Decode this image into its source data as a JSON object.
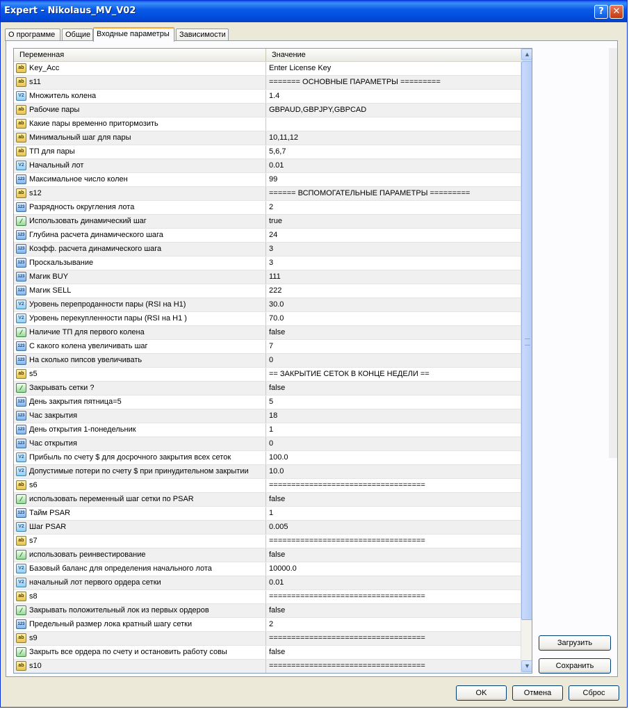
{
  "window": {
    "title": "Expert - Nikolaus_MV_V02",
    "help_glyph": "?",
    "close_glyph": "✕"
  },
  "tabs": [
    {
      "label": "О программе"
    },
    {
      "label": "Общие"
    },
    {
      "label": "Входные параметры"
    },
    {
      "label": "Зависимости"
    }
  ],
  "table": {
    "columns": {
      "name": "Переменная",
      "value": "Значение"
    },
    "rows": [
      {
        "icon": "ab",
        "name": "Key_Acc",
        "value": "Enter License Key"
      },
      {
        "icon": "ab",
        "name": "s11",
        "value": "======= ОСНОВНЫЕ ПАРАМЕТРЫ ========="
      },
      {
        "icon": "v2",
        "name": "Множитель колена",
        "value": "1.4"
      },
      {
        "icon": "ab",
        "name": "Рабочие пары",
        "value": "GBPAUD,GBPJPY,GBPCAD"
      },
      {
        "icon": "ab",
        "name": "Какие пары временно притормозить",
        "value": ""
      },
      {
        "icon": "ab",
        "name": "Минимальный шаг для пары",
        "value": "10,11,12"
      },
      {
        "icon": "ab",
        "name": "ТП для пары",
        "value": "5,6,7"
      },
      {
        "icon": "v2",
        "name": "Начальный лот",
        "value": "0.01"
      },
      {
        "icon": "123",
        "name": "Максимальное число колен",
        "value": "99"
      },
      {
        "icon": "ab",
        "name": "s12",
        "value": "====== ВСПОМОГАТЕЛЬНЫЕ ПАРАМЕТРЫ ========="
      },
      {
        "icon": "123",
        "name": "Разрядность округления лота",
        "value": "2"
      },
      {
        "icon": "bool",
        "name": "Использовать динамический шаг",
        "value": "true"
      },
      {
        "icon": "123",
        "name": "Глубина расчета динамического шага",
        "value": "24"
      },
      {
        "icon": "123",
        "name": "Коэфф. расчета динамического шага",
        "value": "3"
      },
      {
        "icon": "123",
        "name": "Проскальзывание",
        "value": "3"
      },
      {
        "icon": "123",
        "name": "Магик BUY",
        "value": "111"
      },
      {
        "icon": "123",
        "name": "Магик SELL",
        "value": "222"
      },
      {
        "icon": "v2",
        "name": "Уровень перепроданности пары (RSI на H1)",
        "value": "30.0"
      },
      {
        "icon": "v2",
        "name": "Уровень перекупленности пары (RSI на H1 )",
        "value": "70.0"
      },
      {
        "icon": "bool",
        "name": "Наличие ТП для первого колена",
        "value": "false"
      },
      {
        "icon": "123",
        "name": "С какого колена увеличивать шаг",
        "value": "7"
      },
      {
        "icon": "123",
        "name": "На сколько пипсов увеличивать",
        "value": "0"
      },
      {
        "icon": "ab",
        "name": "s5",
        "value": "== ЗАКРЫТИЕ СЕТОК В КОНЦЕ НЕДЕЛИ =="
      },
      {
        "icon": "bool",
        "name": "Закрывать сетки ?",
        "value": "false"
      },
      {
        "icon": "123",
        "name": "День закрытия пятница=5",
        "value": "5"
      },
      {
        "icon": "123",
        "name": "Час закрытия",
        "value": "18"
      },
      {
        "icon": "123",
        "name": "День открытия 1-понедельник",
        "value": "1"
      },
      {
        "icon": "123",
        "name": "Час открытия",
        "value": "0"
      },
      {
        "icon": "v2",
        "name": "Прибыль по счету $ для досрочного закрытия всех сеток",
        "value": "100.0"
      },
      {
        "icon": "v2",
        "name": "Допустимые потери по счету $ при принудительном закрытии",
        "value": "10.0"
      },
      {
        "icon": "ab",
        "name": "s6",
        "value": "==================================="
      },
      {
        "icon": "bool",
        "name": "использовать переменный шаг сетки по PSAR",
        "value": "false"
      },
      {
        "icon": "123",
        "name": "Тайм PSAR",
        "value": "1"
      },
      {
        "icon": "v2",
        "name": "Шаг PSAR",
        "value": "0.005"
      },
      {
        "icon": "ab",
        "name": "s7",
        "value": "==================================="
      },
      {
        "icon": "bool",
        "name": "использовать реинвестирование",
        "value": "false"
      },
      {
        "icon": "v2",
        "name": "Базовый баланс для определения начального лота",
        "value": "10000.0"
      },
      {
        "icon": "v2",
        "name": "начальный лот первого ордера сетки",
        "value": "0.01"
      },
      {
        "icon": "ab",
        "name": "s8",
        "value": "==================================="
      },
      {
        "icon": "bool",
        "name": "Закрывать положительный лок из первых ордеров",
        "value": "false"
      },
      {
        "icon": "123",
        "name": "Предельный размер лока кратный шагу сетки",
        "value": "2"
      },
      {
        "icon": "ab",
        "name": "s9",
        "value": "==================================="
      },
      {
        "icon": "bool",
        "name": "Закрыть все ордера по счету и остановить работу совы",
        "value": "false"
      },
      {
        "icon": "ab",
        "name": "s10",
        "value": "==================================="
      }
    ]
  },
  "icon_glyphs": {
    "ab": "ab",
    "v2": "V2",
    "123": "123",
    "bool": "⁄"
  },
  "buttons": {
    "load": "Загрузить",
    "save": "Сохранить",
    "ok": "OK",
    "cancel": "Отмена",
    "reset": "Сброс"
  },
  "scroll": {
    "up": "▲",
    "down": "▼"
  }
}
